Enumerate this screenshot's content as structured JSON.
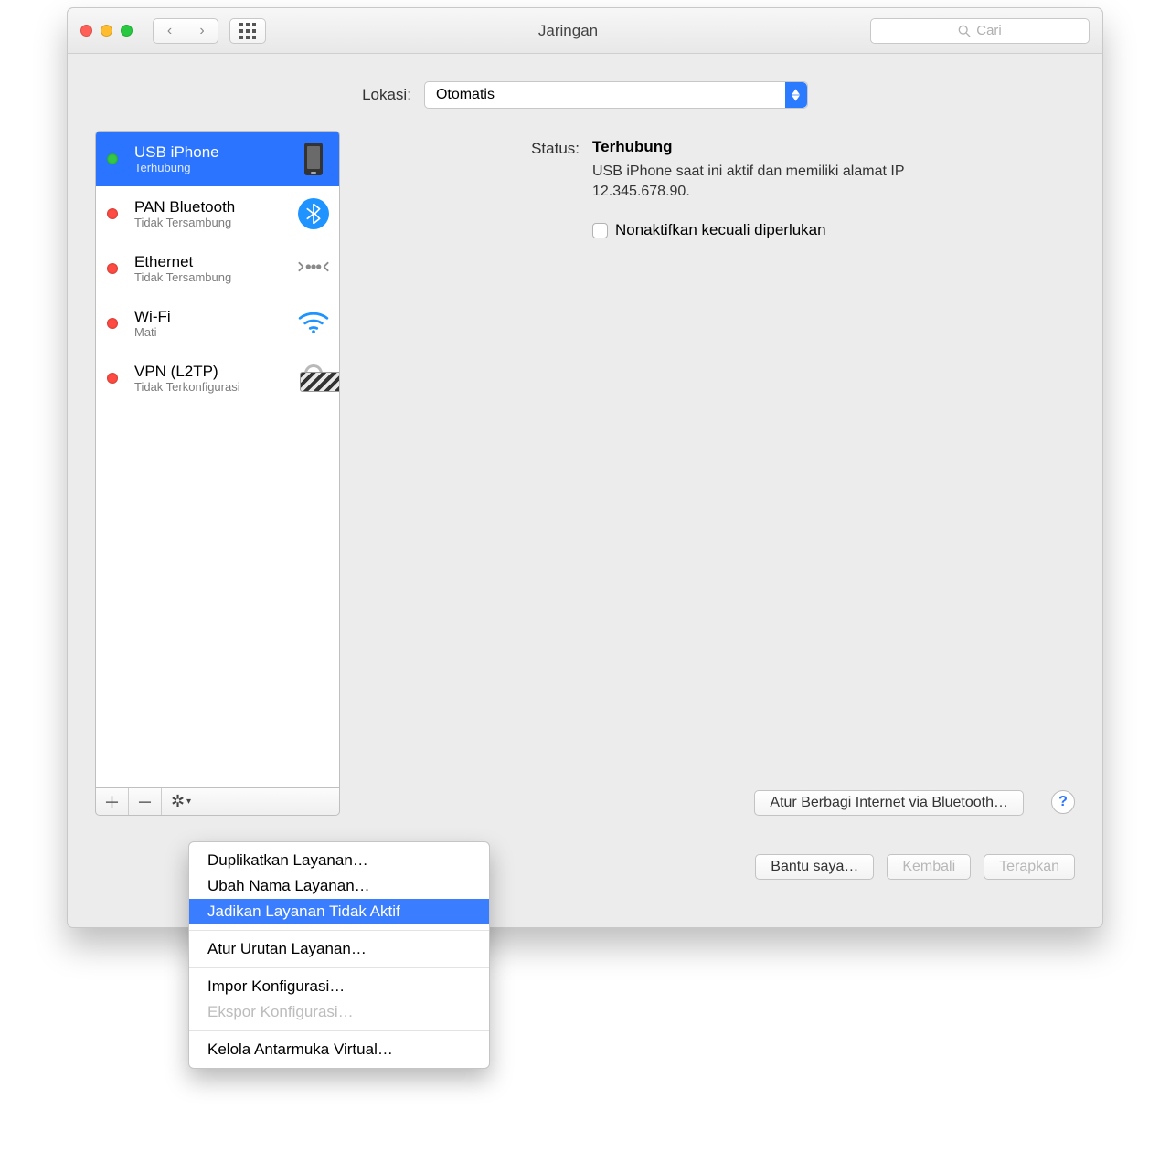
{
  "window": {
    "title": "Jaringan"
  },
  "search": {
    "placeholder": "Cari"
  },
  "location": {
    "label": "Lokasi:",
    "value": "Otomatis"
  },
  "services": [
    {
      "name": "USB iPhone",
      "status": "Terhubung",
      "dot": "green",
      "icon": "iphone",
      "selected": true
    },
    {
      "name": "PAN Bluetooth",
      "status": "Tidak Tersambung",
      "dot": "red",
      "icon": "bluetooth"
    },
    {
      "name": "Ethernet",
      "status": "Tidak Tersambung",
      "dot": "red",
      "icon": "ethernet"
    },
    {
      "name": "Wi-Fi",
      "status": "Mati",
      "dot": "red",
      "icon": "wifi"
    },
    {
      "name": "VPN (L2TP)",
      "status": "Tidak Terkonfigurasi",
      "dot": "red",
      "icon": "vpn"
    }
  ],
  "detail": {
    "status_label": "Status:",
    "status_value": "Terhubung",
    "status_desc": "USB iPhone saat ini aktif dan memiliki alamat IP 12.345.678.90.",
    "disable_checkbox": "Nonaktifkan kecuali diperlukan",
    "advanced_button": "Atur Berbagi Internet via Bluetooth…"
  },
  "footer": {
    "assist": "Bantu saya…",
    "revert": "Kembali",
    "apply": "Terapkan"
  },
  "gear_menu": {
    "items": [
      {
        "label": "Duplikatkan Layanan…"
      },
      {
        "label": "Ubah Nama Layanan…"
      },
      {
        "label": "Jadikan Layanan Tidak Aktif",
        "highlight": true
      },
      {
        "sep": true
      },
      {
        "label": "Atur Urutan Layanan…"
      },
      {
        "sep": true
      },
      {
        "label": "Impor Konfigurasi…"
      },
      {
        "label": "Ekspor Konfigurasi…",
        "disabled": true
      },
      {
        "sep": true
      },
      {
        "label": "Kelola Antarmuka Virtual…"
      }
    ]
  }
}
